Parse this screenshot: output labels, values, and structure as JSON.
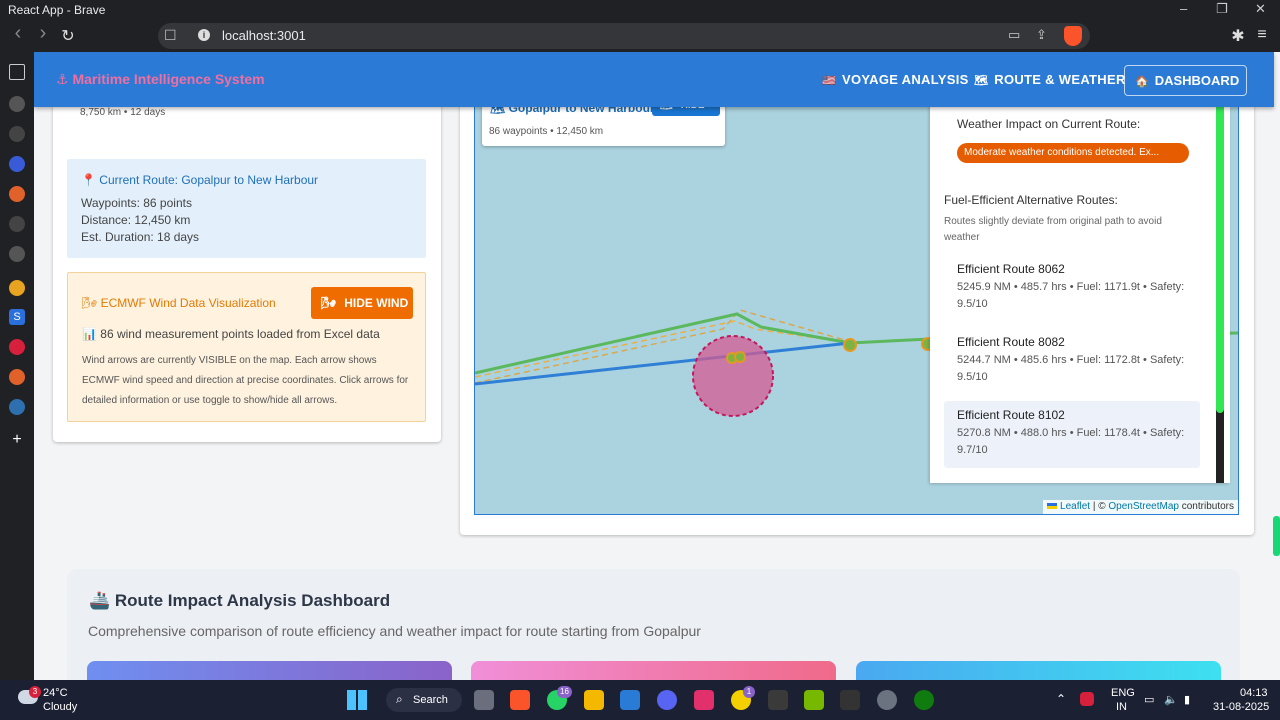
{
  "window": {
    "title": "React App - Brave",
    "min": "–",
    "max": "❐",
    "close": "✕"
  },
  "browser": {
    "url": "localhost:3001",
    "back": "‹",
    "forward": "›",
    "reload": "↻",
    "bookmark": "🔖",
    "menu": "≡"
  },
  "app": {
    "brand": "⚓ Maritime Intelligence System",
    "nav": [
      {
        "icon": "🇺🇸",
        "label": "VOYAGE ANALYSIS"
      },
      {
        "icon": "🗺",
        "label": "ROUTE & WEATHER"
      },
      {
        "icon": "🏠",
        "label": "DASHBOARD"
      }
    ]
  },
  "leftcard": {
    "top_line": "8,750 km • 12 days",
    "current_route": {
      "title": "📍 Current Route: Gopalpur to New Harbour",
      "waypoints": "Waypoints: 86 points",
      "distance": "Distance: 12,450 km",
      "duration": "Est. Duration: 18 days"
    },
    "wind": {
      "title": "🌬 ECMWF Wind Data Visualization",
      "button": "HIDE WIND",
      "loaded": "📊 86 wind measurement points loaded from Excel data",
      "desc": "Wind arrows are currently VISIBLE on the map. Each arrow shows ECMWF wind speed and direction at precise coordinates. Click arrows for detailed information or use toggle to show/hide all arrows."
    }
  },
  "map": {
    "route_label": "🗺 Gopalpur to New Harbour",
    "route_stats": "86 waypoints • 12,450 km",
    "hide_button": "HIDE",
    "attribution": {
      "leaflet": "Leaflet",
      "sep": " | © ",
      "osm": "OpenStreetMap",
      "contrib": " contributors"
    }
  },
  "weather_panel": {
    "impact_title": "Weather Impact on Current Route:",
    "impact_badge": "Moderate weather conditions detected. Ex...",
    "alt_title": "Fuel-Efficient Alternative Routes:",
    "alt_note": "Routes slightly deviate from original path to avoid weather",
    "routes": [
      {
        "name": "Efficient Route 8062",
        "details": "5245.9 NM • 485.7 hrs • Fuel: 1171.9t • Safety: 9.5/10"
      },
      {
        "name": "Efficient Route 8082",
        "details": "5244.7 NM • 485.6 hrs • Fuel: 1172.8t • Safety: 9.5/10"
      },
      {
        "name": "Efficient Route 8102",
        "details": "5270.8 NM • 488.0 hrs • Fuel: 1178.4t • Safety: 9.7/10"
      }
    ]
  },
  "dashboard": {
    "title": "🚢 Route Impact Analysis Dashboard",
    "subtitle": "Comprehensive comparison of route efficiency and weather impact for route starting from Gopalpur"
  },
  "taskbar": {
    "weather_temp": "24°C",
    "weather_desc": "Cloudy",
    "weather_badge": "3",
    "search": "Search",
    "whatsapp_badge": "16",
    "app_badge": "1",
    "lang1": "ENG",
    "lang2": "IN",
    "time": "04:13",
    "date": "31-08-2025"
  },
  "colors": {
    "appbar": "#2b7bd6",
    "brand": "#f06ea0",
    "route_green": "#5cb85c",
    "route_blue": "#2f7fd6",
    "weather_zone": "#d45b93"
  }
}
